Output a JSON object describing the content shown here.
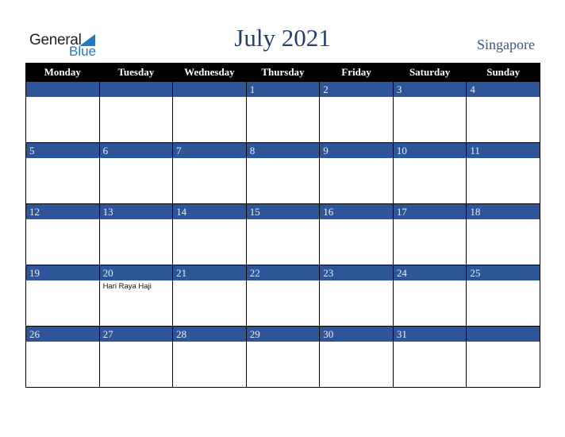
{
  "logo": {
    "word1": "General",
    "word2": "Blue"
  },
  "title": "July 2021",
  "country": "Singapore",
  "colors": {
    "header_bg": "#000000",
    "band_bg": "#2e5597",
    "title": "#253f6d",
    "logo_blue": "#1f7ac4"
  },
  "weekdays": [
    "Monday",
    "Tuesday",
    "Wednesday",
    "Thursday",
    "Friday",
    "Saturday",
    "Sunday"
  ],
  "weeks": [
    [
      {
        "day": ""
      },
      {
        "day": ""
      },
      {
        "day": ""
      },
      {
        "day": "1"
      },
      {
        "day": "2"
      },
      {
        "day": "3"
      },
      {
        "day": "4"
      }
    ],
    [
      {
        "day": "5"
      },
      {
        "day": "6"
      },
      {
        "day": "7"
      },
      {
        "day": "8"
      },
      {
        "day": "9"
      },
      {
        "day": "10"
      },
      {
        "day": "11"
      }
    ],
    [
      {
        "day": "12"
      },
      {
        "day": "13"
      },
      {
        "day": "14"
      },
      {
        "day": "15"
      },
      {
        "day": "16"
      },
      {
        "day": "17"
      },
      {
        "day": "18"
      }
    ],
    [
      {
        "day": "19"
      },
      {
        "day": "20",
        "event": "Hari Raya Haji"
      },
      {
        "day": "21"
      },
      {
        "day": "22"
      },
      {
        "day": "23"
      },
      {
        "day": "24"
      },
      {
        "day": "25"
      }
    ],
    [
      {
        "day": "26"
      },
      {
        "day": "27"
      },
      {
        "day": "28"
      },
      {
        "day": "29"
      },
      {
        "day": "30"
      },
      {
        "day": "31"
      },
      {
        "day": ""
      }
    ]
  ]
}
